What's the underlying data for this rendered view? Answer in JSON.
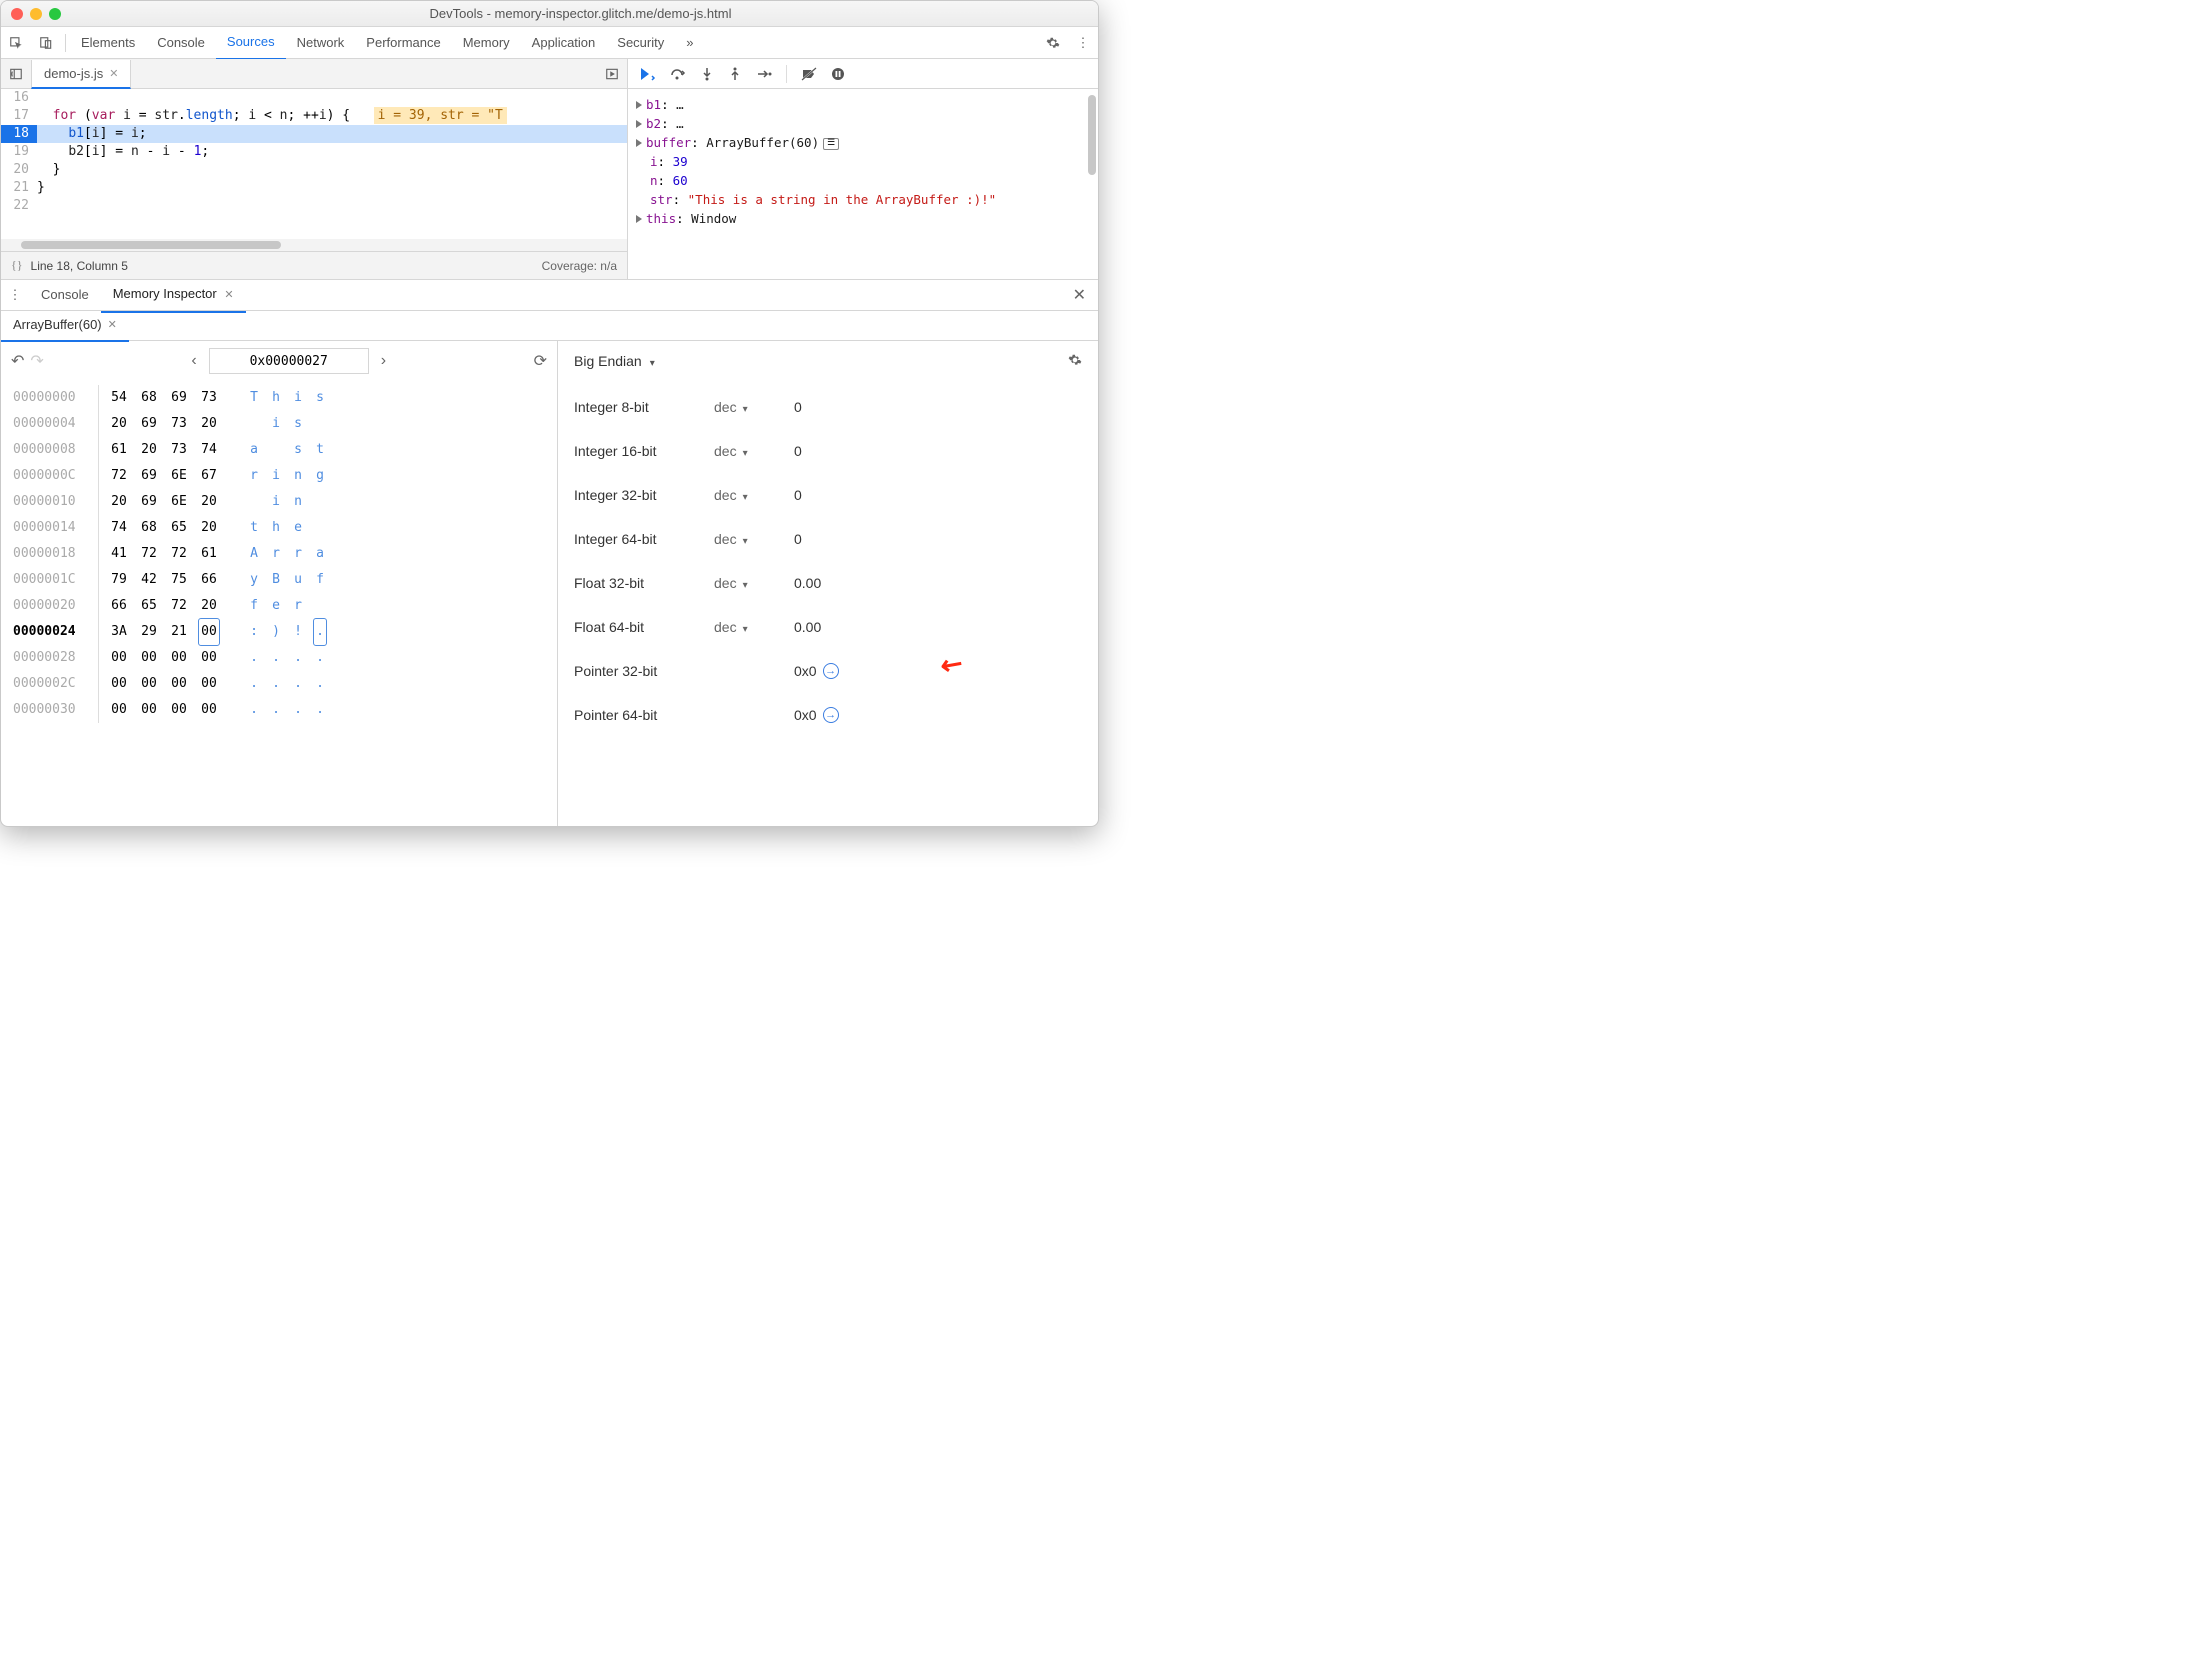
{
  "window": {
    "title": "DevTools - memory-inspector.glitch.me/demo-js.html"
  },
  "tabs": [
    "Elements",
    "Console",
    "Sources",
    "Network",
    "Performance",
    "Memory",
    "Application",
    "Security"
  ],
  "tabs_active_index": 2,
  "more_tabs_glyph": "»",
  "file_tab": {
    "name": "demo-js.js"
  },
  "code": {
    "lines": [
      {
        "n": 16,
        "t": ""
      },
      {
        "n": 17,
        "t_html": "  <span class=kw>for</span> (<span class=kw>var</span> <span class=id>i</span> = <span class=id>str</span>.<span class=bl>length</span>; <span class=id>i</span> &lt; <span class=id>n</span>; ++<span class=id>i</span>) {   <span class=inlinevals>i = 39, str = \"T</span>"
      },
      {
        "n": 18,
        "t_html": "    <span class=bl>b1</span>[<span class=id>i</span>] = <span class=id>i</span>;",
        "exec": true
      },
      {
        "n": 19,
        "t_html": "    <span class=id>b2</span>[<span class=id>i</span>] = <span class=id>n</span> - <span class=id>i</span> - <span class=num>1</span>;"
      },
      {
        "n": 20,
        "t_html": "  }"
      },
      {
        "n": 21,
        "t_html": "}"
      },
      {
        "n": 22,
        "t_html": ""
      }
    ]
  },
  "status": {
    "left_icon": "{}",
    "position": "Line 18, Column 5",
    "coverage": "Coverage: n/a"
  },
  "scope": {
    "b1": "…",
    "b2": "…",
    "buffer_label": "buffer",
    "buffer_type": "ArrayBuffer(60)",
    "i_label": "i",
    "i": "39",
    "n_label": "n",
    "n": "60",
    "str_label": "str",
    "str": "\"This is a string in the ArrayBuffer :)!\"",
    "this_label": "this",
    "this": "Window"
  },
  "drawer": {
    "tabs": [
      "Console",
      "Memory Inspector"
    ],
    "active": 1
  },
  "buffer_tab_label": "ArrayBuffer(60)",
  "hex": {
    "address": "0x00000027",
    "rows": [
      {
        "addr": "00000000",
        "b": [
          "54",
          "68",
          "69",
          "73"
        ],
        "a": [
          "T",
          "h",
          "i",
          "s"
        ]
      },
      {
        "addr": "00000004",
        "b": [
          "20",
          "69",
          "73",
          "20"
        ],
        "a": [
          " ",
          "i",
          "s",
          " "
        ]
      },
      {
        "addr": "00000008",
        "b": [
          "61",
          "20",
          "73",
          "74"
        ],
        "a": [
          "a",
          " ",
          "s",
          "t"
        ]
      },
      {
        "addr": "0000000C",
        "b": [
          "72",
          "69",
          "6E",
          "67"
        ],
        "a": [
          "r",
          "i",
          "n",
          "g"
        ]
      },
      {
        "addr": "00000010",
        "b": [
          "20",
          "69",
          "6E",
          "20"
        ],
        "a": [
          " ",
          "i",
          "n",
          " "
        ]
      },
      {
        "addr": "00000014",
        "b": [
          "74",
          "68",
          "65",
          "20"
        ],
        "a": [
          "t",
          "h",
          "e",
          " "
        ]
      },
      {
        "addr": "00000018",
        "b": [
          "41",
          "72",
          "72",
          "61"
        ],
        "a": [
          "A",
          "r",
          "r",
          "a"
        ]
      },
      {
        "addr": "0000001C",
        "b": [
          "79",
          "42",
          "75",
          "66"
        ],
        "a": [
          "y",
          "B",
          "u",
          "f"
        ]
      },
      {
        "addr": "00000020",
        "b": [
          "66",
          "65",
          "72",
          "20"
        ],
        "a": [
          "f",
          "e",
          "r",
          " "
        ]
      },
      {
        "addr": "00000024",
        "b": [
          "3A",
          "29",
          "21",
          "00"
        ],
        "a": [
          ":",
          ")",
          "!",
          "."
        ],
        "cur": true,
        "sel": 3
      },
      {
        "addr": "00000028",
        "b": [
          "00",
          "00",
          "00",
          "00"
        ],
        "a": [
          ".",
          ".",
          ".",
          "."
        ]
      },
      {
        "addr": "0000002C",
        "b": [
          "00",
          "00",
          "00",
          "00"
        ],
        "a": [
          ".",
          ".",
          ".",
          "."
        ]
      },
      {
        "addr": "00000030",
        "b": [
          "00",
          "00",
          "00",
          "00"
        ],
        "a": [
          ".",
          ".",
          ".",
          "."
        ]
      }
    ]
  },
  "values": {
    "endian": "Big Endian",
    "rows": [
      {
        "label": "Integer 8-bit",
        "mode": "dec",
        "val": "0"
      },
      {
        "label": "Integer 16-bit",
        "mode": "dec",
        "val": "0"
      },
      {
        "label": "Integer 32-bit",
        "mode": "dec",
        "val": "0"
      },
      {
        "label": "Integer 64-bit",
        "mode": "dec",
        "val": "0"
      },
      {
        "label": "Float 32-bit",
        "mode": "dec",
        "val": "0.00"
      },
      {
        "label": "Float 64-bit",
        "mode": "dec",
        "val": "0.00"
      },
      {
        "label": "Pointer 32-bit",
        "mode": "",
        "val": "0x0",
        "jump": true
      },
      {
        "label": "Pointer 64-bit",
        "mode": "",
        "val": "0x0",
        "jump": true
      }
    ]
  }
}
